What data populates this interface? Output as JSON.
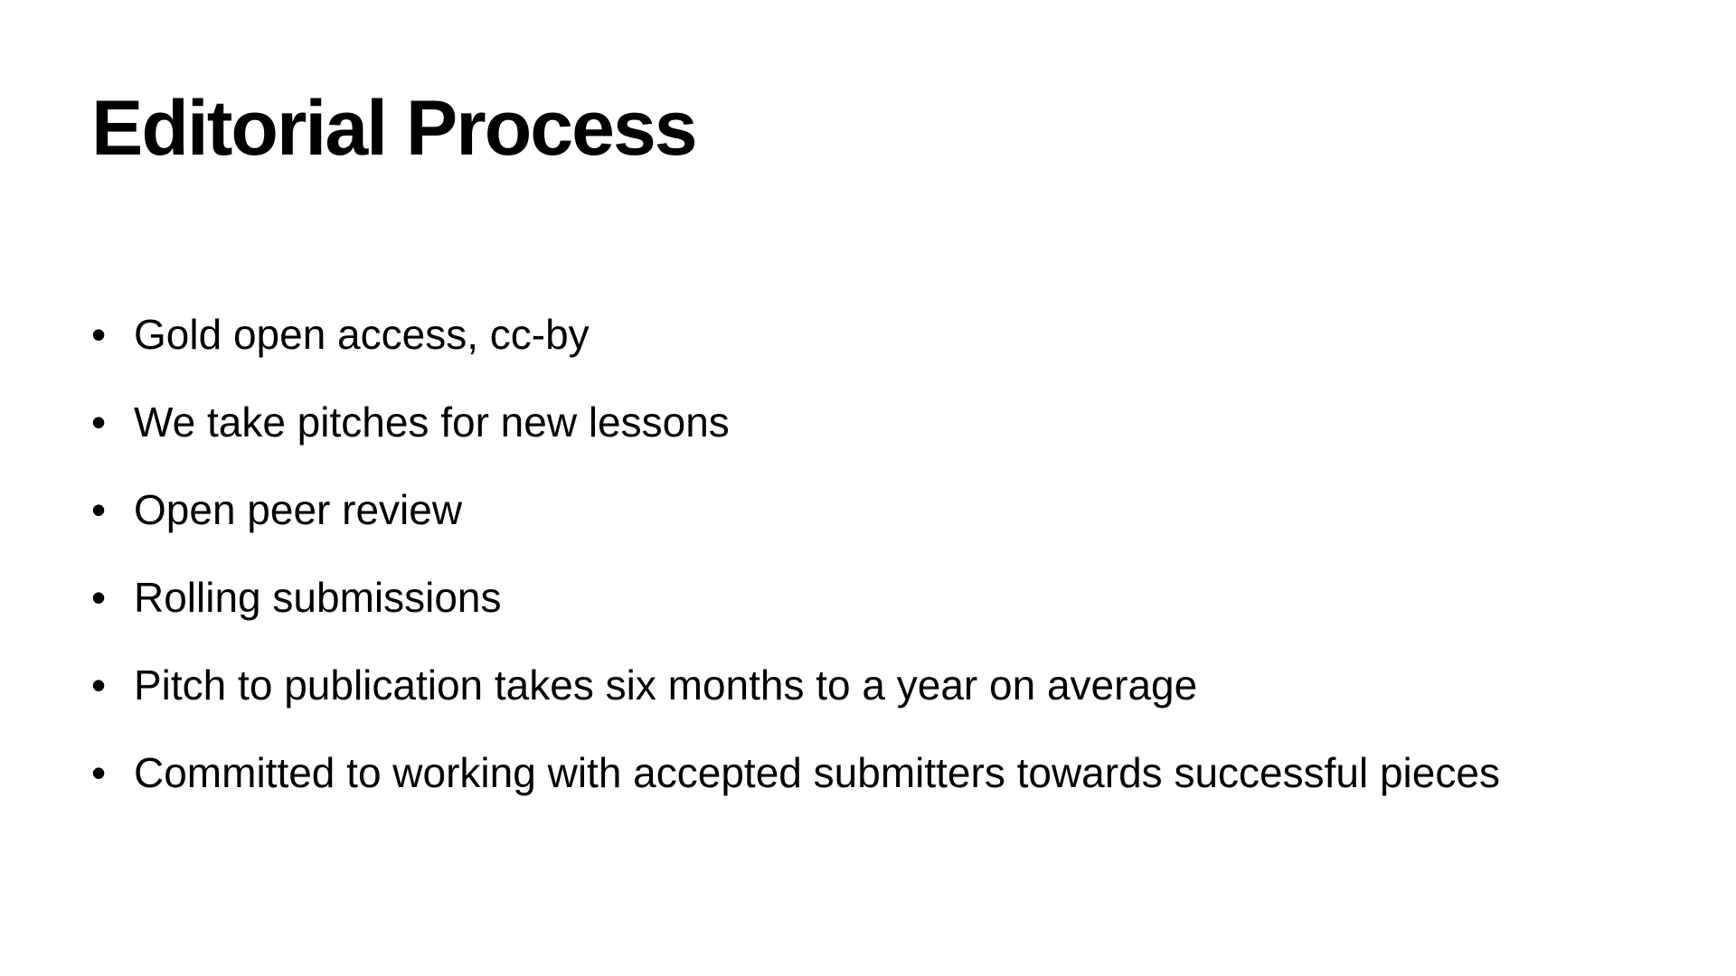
{
  "slide": {
    "title": "Editorial Process",
    "bullet_glyph": "•",
    "bullets": [
      "Gold open access, cc-by",
      "We take pitches for new lessons",
      "Open peer review",
      "Rolling submissions",
      "Pitch to publication takes six months to a year on average",
      "Committed to working with accepted submitters towards successful pieces"
    ]
  }
}
